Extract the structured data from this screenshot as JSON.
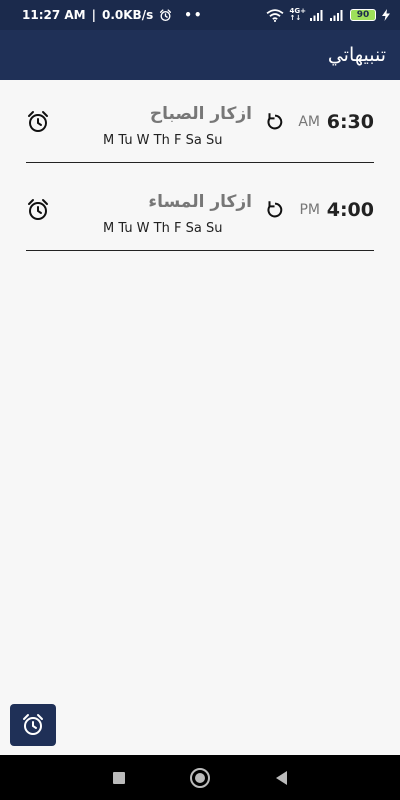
{
  "status_bar": {
    "time": "11:27 AM",
    "separator": "|",
    "network_speed": "0.0KB/s",
    "dots": "••",
    "net_label_top": "4G+",
    "net_label_bottom": "↑↓",
    "battery": "90"
  },
  "app_bar": {
    "title": "تنبيهاتي"
  },
  "alarms": [
    {
      "time": "6:30",
      "ampm": "AM",
      "label": "ازكار الصباح",
      "days": "M Tu W Th F Sa Su"
    },
    {
      "time": "4:00",
      "ampm": "PM",
      "label": "ازكار المساء",
      "days": "M Tu W Th F Sa Su"
    }
  ],
  "colors": {
    "status_bar": "#1b2a4c",
    "app_bar": "#1f3057",
    "fab": "#1f3057",
    "background": "#f7f7f7",
    "battery": "#9ee05a"
  },
  "icons": {
    "alarm": "alarm-clock-icon",
    "repeat": "repeat-icon",
    "fab": "add-alarm-icon"
  }
}
